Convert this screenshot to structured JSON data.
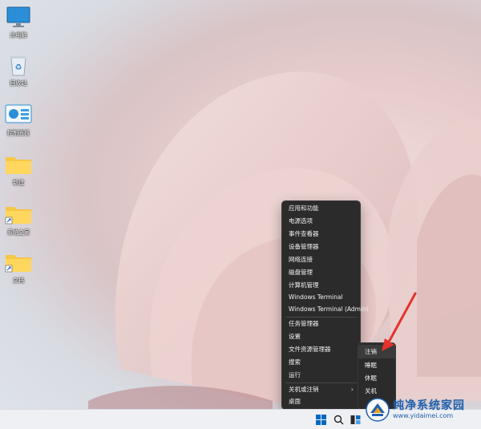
{
  "desktop": {
    "icons": [
      {
        "name": "此电脑",
        "icon": "monitor-icon"
      },
      {
        "name": "回收站",
        "icon": "recycle-bin-icon"
      },
      {
        "name": "控制面板",
        "icon": "control-panel-icon"
      },
      {
        "name": "新建",
        "icon": "folder-icon"
      },
      {
        "name": "系统之家",
        "icon": "folder-shortcut-icon"
      },
      {
        "name": "文档",
        "icon": "folder-shortcut-icon"
      }
    ]
  },
  "context_menu": {
    "items": [
      "应用和功能",
      "电源选项",
      "事件查看器",
      "设备管理器",
      "网络连接",
      "磁盘管理",
      "计算机管理",
      "Windows Terminal",
      "Windows Terminal (Admin)",
      "任务管理器",
      "设置",
      "文件资源管理器",
      "搜索",
      "运行",
      "关机或注销",
      "桌面"
    ]
  },
  "submenu": {
    "items": [
      "注销",
      "睡眠",
      "休眠",
      "关机"
    ],
    "highlighted": "注销"
  },
  "annotation": {
    "arrow_color": "#e5322d"
  },
  "taskbar": {
    "buttons": [
      "start-icon",
      "search-icon",
      "task-view-icon"
    ]
  },
  "watermark": {
    "title": "纯净系统家园",
    "url": "www.yidaimei.com"
  },
  "colors": {
    "accent": "#0067c0",
    "menu_bg": "#2b2b2b",
    "watermark": "#1e5fae"
  }
}
